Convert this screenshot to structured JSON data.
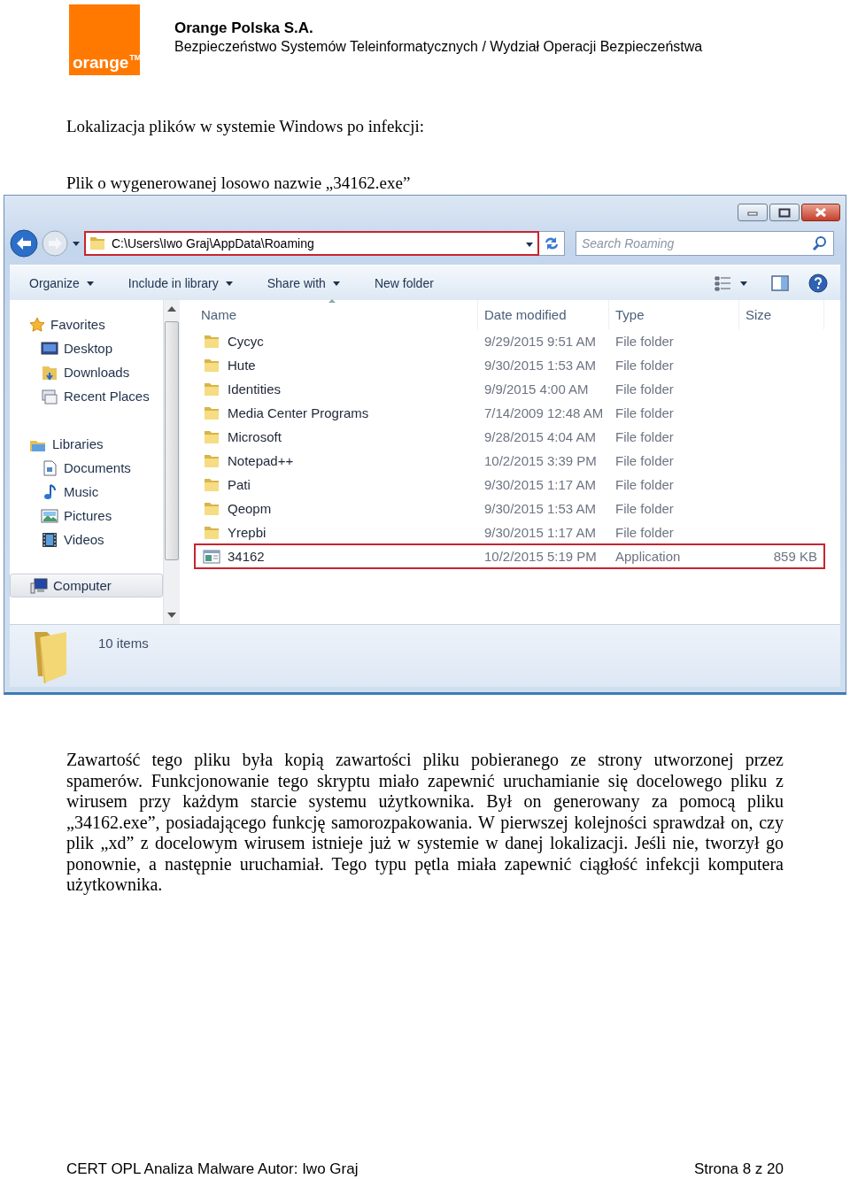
{
  "header": {
    "logo": "orange",
    "trademark": "TM",
    "company": "Orange Polska S.A.",
    "department": "Bezpieczeństwo Systemów Teleinformatycznych / Wydział Operacji Bezpieczeństwa"
  },
  "heading": "Lokalizacja plików w systemie Windows po infekcji:",
  "caption": "Plik o wygenerowanej losowo nazwie „34162.exe”",
  "explorer": {
    "address": {
      "value": "C:\\Users\\Iwo Graj\\AppData\\Roaming",
      "highlighted": true
    },
    "search": {
      "placeholder": "Search Roaming"
    },
    "toolbar": [
      {
        "label": "Organize",
        "menu": true
      },
      {
        "label": "Include in library",
        "menu": true
      },
      {
        "label": "Share with",
        "menu": true
      },
      {
        "label": "New folder",
        "menu": false
      }
    ],
    "nav": [
      {
        "label": "Favorites",
        "selected": false,
        "children": [
          {
            "label": "Desktop",
            "selected": false
          },
          {
            "label": "Downloads",
            "selected": false
          },
          {
            "label": "Recent Places",
            "selected": false
          }
        ]
      },
      {
        "label": "Libraries",
        "selected": false,
        "children": [
          {
            "label": "Documents",
            "selected": false
          },
          {
            "label": "Music",
            "selected": false
          },
          {
            "label": "Pictures",
            "selected": false
          },
          {
            "label": "Videos",
            "selected": false
          }
        ]
      },
      {
        "label": "Computer",
        "selected": true
      }
    ],
    "columns": [
      "Name",
      "Date modified",
      "Type",
      "Size"
    ],
    "rows": [
      {
        "kind": "folder",
        "name": "Cycyc",
        "date": "9/29/2015 9:51 AM",
        "type": "File folder",
        "highlighted": false
      },
      {
        "kind": "folder",
        "name": "Hute",
        "date": "9/30/2015 1:53 AM",
        "type": "File folder",
        "highlighted": false
      },
      {
        "kind": "folder",
        "name": "Identities",
        "date": "9/9/2015 4:00 AM",
        "type": "File folder",
        "highlighted": false
      },
      {
        "kind": "folder",
        "name": "Media Center Programs",
        "date": "7/14/2009 12:48 AM",
        "type": "File folder",
        "highlighted": false
      },
      {
        "kind": "folder",
        "name": "Microsoft",
        "date": "9/28/2015 4:04 AM",
        "type": "File folder",
        "highlighted": false
      },
      {
        "kind": "folder",
        "name": "Notepad++",
        "date": "10/2/2015 3:39 PM",
        "type": "File folder",
        "highlighted": false
      },
      {
        "kind": "folder",
        "name": "Pati",
        "date": "9/30/2015 1:17 AM",
        "type": "File folder",
        "highlighted": false
      },
      {
        "kind": "folder",
        "name": "Qeopm",
        "date": "9/30/2015 1:53 AM",
        "type": "File folder",
        "highlighted": false
      },
      {
        "kind": "folder",
        "name": "Yrepbi",
        "date": "9/30/2015 1:17 AM",
        "type": "File folder",
        "highlighted": false
      },
      {
        "kind": "application",
        "name": "34162",
        "date": "10/2/2015 5:19 PM",
        "type": "Application",
        "size": "859 KB",
        "highlighted": true
      }
    ],
    "status": "10 items"
  },
  "paragraph": "Zawartość tego pliku była kopią zawartości pliku pobieranego ze strony utworzonej przez spamerów. Funkcjonowanie tego skryptu miało zapewnić uruchamianie się docelowego pliku z wirusem przy każdym starcie systemu użytkownika. Był on generowany za pomocą pliku „34162.exe”, posiadającego funkcję samorozpakowania. W pierwszej kolejności sprawdzał on, czy plik „xd” z docelowym wirusem istnieje już w systemie w danej lokalizacji. Jeśli nie, tworzył go ponownie, a następnie uruchamiał. Tego typu pętla miała zapewnić ciągłość infekcji komputera użytkownika.",
  "footer": {
    "left": "CERT OPL Analiza Malware Autor: Iwo Graj",
    "right": "Strona 8 z 20"
  }
}
